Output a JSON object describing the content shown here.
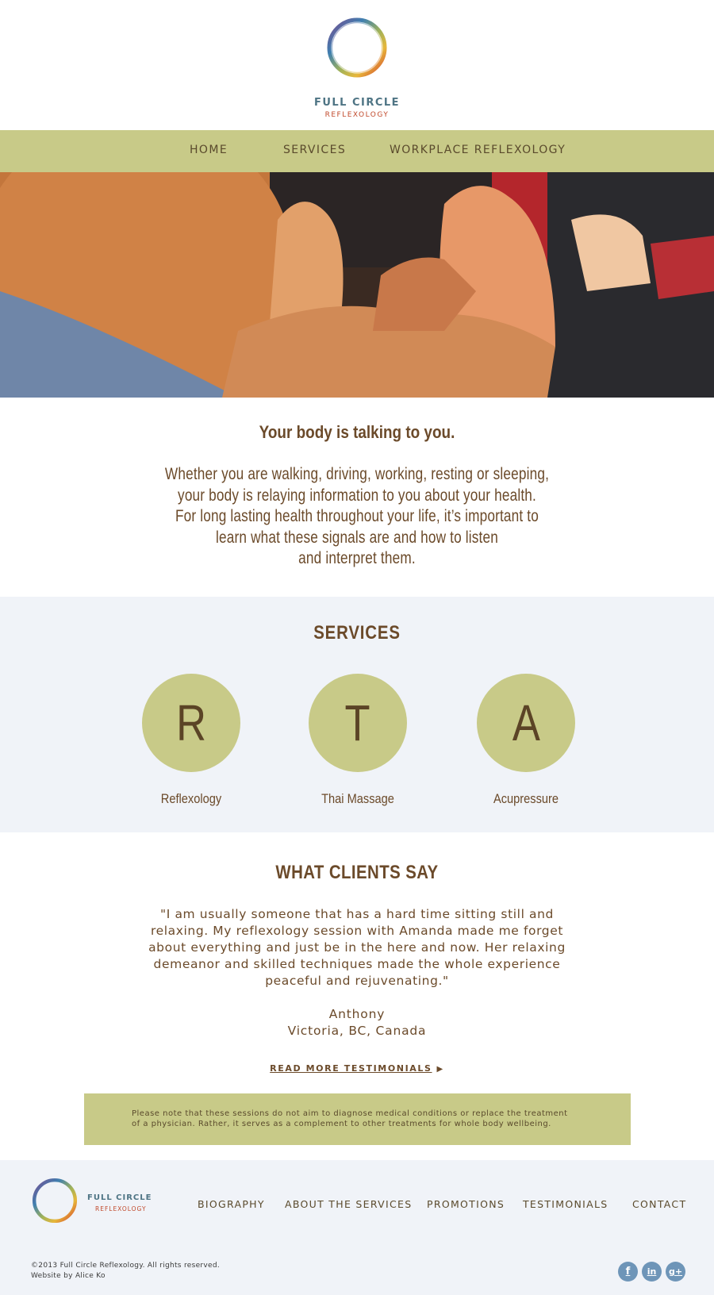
{
  "brand": {
    "name": "FULL CIRCLE",
    "sub": "REFLEXOLOGY"
  },
  "nav": {
    "items": [
      "HOME",
      "SERVICES",
      "WORKPLACE REFLEXOLOGY"
    ]
  },
  "hero": {
    "image": "reflexology-foot-massage-photo"
  },
  "intro": {
    "title": "Your body is talking to you.",
    "lines": [
      "Whether you are walking, driving, working, resting or sleeping,",
      "your body is relaying information to you about your health.",
      "For long lasting health throughout your life, it’s important to",
      "learn what these signals are and how to listen",
      "and interpret them."
    ]
  },
  "services": {
    "title": "SERVICES",
    "items": [
      {
        "letter": "R",
        "label": "Reflexology"
      },
      {
        "letter": "T",
        "label": "Thai Massage"
      },
      {
        "letter": "A",
        "label": "Acupressure"
      }
    ]
  },
  "testimonials": {
    "title": "WHAT CLIENTS SAY",
    "quote_lines": [
      "\"I am usually someone that has a hard time sitting still and",
      "relaxing. My reflexology session with Amanda made me forget",
      "about everything and just be in the here and now. Her relaxing",
      "demeanor and skilled techniques made the whole experience",
      "peaceful and rejuvenating.\""
    ],
    "author": "Anthony",
    "location": "Victoria, BC, Canada",
    "read_more": "READ MORE TESTIMONIALS",
    "arrow": "▶"
  },
  "disclaimer": {
    "lines": [
      "Please note that these sessions do not aim to diagnose medical conditions or replace the treatment",
      "of a physician. Rather, it serves as a complement to other treatments for whole body wellbeing."
    ]
  },
  "footer": {
    "links": [
      "BIOGRAPHY",
      "ABOUT THE SERVICES",
      "PROMOTIONS",
      "TESTIMONIALS",
      "CONTACT"
    ],
    "copyright": "©2013 Full Circle Reflexology. All rights reserved.",
    "credit": "Website by Alice Ko",
    "social": [
      {
        "icon": "facebook-icon",
        "glyph": "f"
      },
      {
        "icon": "linkedin-icon",
        "glyph": "in"
      },
      {
        "icon": "google-plus-icon",
        "glyph": "g+"
      }
    ]
  },
  "colors": {
    "accent_green": "#c8ca88",
    "text_brown": "#6b4a2a",
    "panel_blue": "#f0f3f8",
    "brand_teal": "#4e7484",
    "brand_red": "#c1492b",
    "social_blue": "#6e95b8"
  }
}
